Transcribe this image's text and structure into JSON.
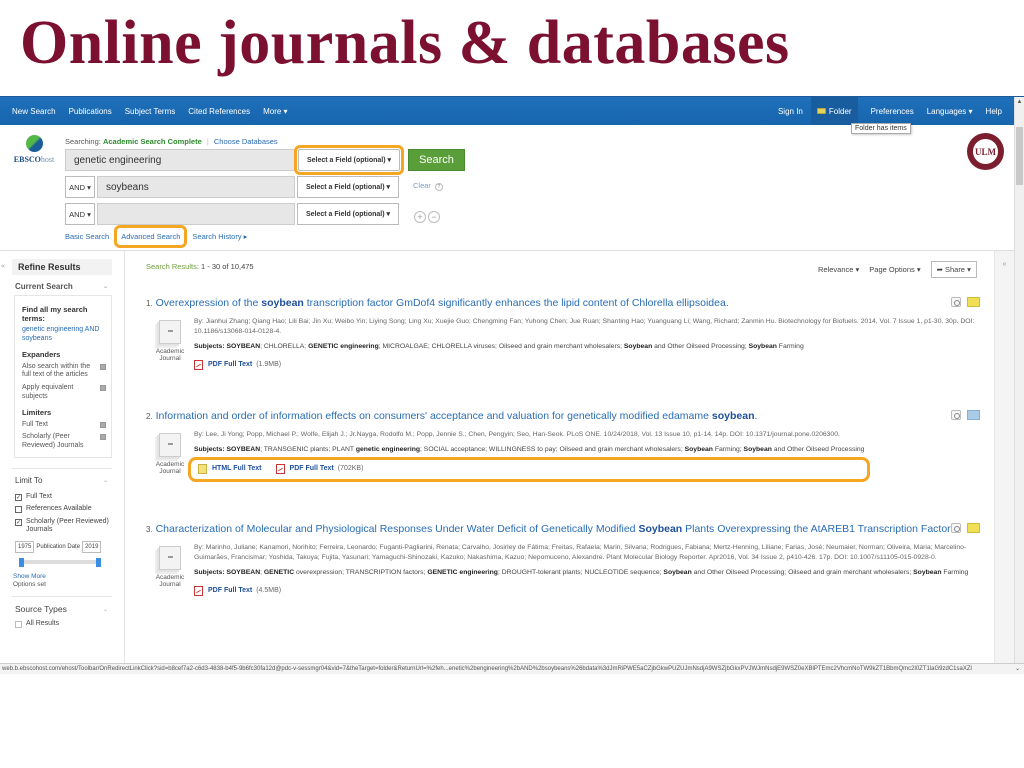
{
  "slide": {
    "title": "Online journals & databases"
  },
  "topnav": {
    "left": [
      "New Search",
      "Publications",
      "Subject Terms",
      "Cited References",
      "More ▾"
    ],
    "sign_in": "Sign In",
    "folder": "Folder",
    "preferences": "Preferences",
    "languages": "Languages ▾",
    "help": "Help",
    "folder_tooltip": "Folder has items"
  },
  "logo": {
    "brand": "EBSCO",
    "brand_suffix": "host"
  },
  "search": {
    "searching_label": "Searching:",
    "database": "Academic Search Complete",
    "choose_databases": "Choose Databases",
    "rows": [
      {
        "bool": "",
        "term": "genetic engineering",
        "field": "Select a Field (optional) ▾"
      },
      {
        "bool": "AND ▾",
        "term": "soybeans",
        "field": "Select a Field (optional) ▾"
      },
      {
        "bool": "AND ▾",
        "term": "",
        "field": "Select a Field (optional) ▾"
      }
    ],
    "search_button": "Search",
    "clear": "Clear",
    "help_glyph": "?",
    "add_row": "+",
    "remove_row": "−",
    "basic_search": "Basic Search",
    "advanced_search": "Advanced Search",
    "search_history": "Search History ▸"
  },
  "institution": {
    "seal_text": "ULM"
  },
  "sidebar": {
    "collapse_glyph": "«",
    "refine_results": "Refine Results",
    "current_search": "Current Search",
    "find_all_label": "Find all my search terms:",
    "find_all_value": "genetic engineering AND soybeans",
    "expanders_label": "Expanders",
    "expanders": [
      "Also search within the full text of the articles",
      "Apply equivalent subjects"
    ],
    "limiters_label": "Limiters",
    "limiters": [
      "Full Text",
      "Scholarly (Peer Reviewed) Journals"
    ],
    "limit_to": "Limit To",
    "limit_options": [
      {
        "label": "Full Text",
        "checked": true
      },
      {
        "label": "References Available",
        "checked": false
      },
      {
        "label": "Scholarly (Peer Reviewed) Journals",
        "checked": true
      }
    ],
    "pub_date_from": "1975",
    "pub_date_label": "Publication Date",
    "pub_date_to": "2019",
    "show_more": "Show More",
    "options_set": "Options set",
    "source_types": "Source Types",
    "all_results": "All Results"
  },
  "results_header": {
    "label": "Search Results:",
    "range": "1 - 30 of 10,475",
    "relevance": "Relevance ▾",
    "page_options": "Page Options ▾",
    "share": "Share ▾"
  },
  "results": [
    {
      "num": "1.",
      "title_pre": "Overexpression of the ",
      "title_bold": "soybean",
      "title_post": " transcription factor GmDof4 significantly enhances the lipid content of Chlorella ellipsoidea.",
      "pub_type": "Academic Journal",
      "byline": "By: Jianhui Zhang; Qiang Hao; Lili Bai; Jin Xu; Weibo Yin; Liying Song; Ling Xu; Xuejie Guo; Chengming Fan; Yuhong Chen; Jue Ruan; Shanting Hao; Yuanguang Li; Wang, Richard; Zanmin Hu. Biotechnology for Biofuels. 2014, Vol. 7 Issue 1, p1-30. 30p. DOI: 10.1186/s13068-014-0128-4.",
      "subjects": [
        {
          "t": "Subjects: ",
          "b": true
        },
        {
          "t": "SOYBEAN",
          "b": true
        },
        {
          "t": "; CHLORELLA; ",
          "b": false
        },
        {
          "t": "GENETIC engineering",
          "b": true
        },
        {
          "t": "; MICROALGAE; CHLORELLA viruses; Oilseed and grain merchant wholesalers; ",
          "b": false
        },
        {
          "t": "Soybean",
          "b": true
        },
        {
          "t": " and Other Oilseed Processing; ",
          "b": false
        },
        {
          "t": "Soybean",
          "b": true
        },
        {
          "t": " Farming",
          "b": false
        }
      ],
      "links": [
        {
          "type": "pdf",
          "label": "PDF Full Text",
          "size": "(1.9MB)"
        }
      ],
      "in_folder": false
    },
    {
      "num": "2.",
      "title_pre": "Information and order of information effects on consumers' acceptance and valuation for genetically modified edamame ",
      "title_bold": "soybean",
      "title_post": ".",
      "pub_type": "Academic Journal",
      "byline": "By: Lee, Ji Yong; Popp, Michael P.; Wolfe, Elijah J.; Jr.Nayga, Rodolfo M.; Popp, Jennie S.; Chen, Pengyin; Seo, Han-Seok. PLoS ONE. 10/24/2018, Vol. 13 Issue 10, p1-14. 14p. DOI: 10.1371/journal.pone.0206300.",
      "subjects": [
        {
          "t": "Subjects: ",
          "b": true
        },
        {
          "t": "SOYBEAN",
          "b": true
        },
        {
          "t": "; TRANSGENIC plants; PLANT ",
          "b": false
        },
        {
          "t": "genetic engineering",
          "b": true
        },
        {
          "t": "; SOCIAL acceptance; WILLINGNESS to pay; Oilseed and grain merchant wholesalers; ",
          "b": false
        },
        {
          "t": "Soybean",
          "b": true
        },
        {
          "t": " Farming; ",
          "b": false
        },
        {
          "t": "Soybean",
          "b": true
        },
        {
          "t": " and Other Oilseed Processing",
          "b": false
        }
      ],
      "links": [
        {
          "type": "html",
          "label": "HTML Full Text",
          "size": ""
        },
        {
          "type": "pdf",
          "label": "PDF Full Text",
          "size": "(702KB)"
        }
      ],
      "in_folder": true
    },
    {
      "num": "3.",
      "title_pre": "Characterization of Molecular and Physiological Responses Under Water Deficit of Genetically Modified ",
      "title_bold": "Soybean",
      "title_post": " Plants Overexpressing the AtAREB1 Transcription Factor.",
      "pub_type": "Academic Journal",
      "byline": "By: Marinho, Juliane; Kanamori, Norihito; Ferreira, Leonardo; Fuganti-Pagliarini, Renata; Carvalho, Josirley de Fátima; Freitas, Rafaela; Marin, Silvana; Rodrigues, Fabiana; Mertz-Henning, Liliane; Farias, José; Neumaier, Norman; Oliveira, Maria; Marcelino-Guimarães, Francismar; Yoshida, Takuya; Fujita, Yasunari; Yamaguchi-Shinozaki, Kazuko; Nakashima, Kazuo; Nepomuceno, Alexandre. Plant Molecular Biology Reporter. Apr2016, Vol. 34 Issue 2, p410-426. 17p. DOI: 10.1007/s11105-015-0928-0.",
      "subjects": [
        {
          "t": "Subjects: ",
          "b": true
        },
        {
          "t": "SOYBEAN",
          "b": true
        },
        {
          "t": "; ",
          "b": false
        },
        {
          "t": "GENETIC",
          "b": true
        },
        {
          "t": " overexpression; TRANSCRIPTION factors; ",
          "b": false
        },
        {
          "t": "GENETIC engineering",
          "b": true
        },
        {
          "t": "; DROUGHT-tolerant plants; NUCLEOTIDE sequence; ",
          "b": false
        },
        {
          "t": "Soybean",
          "b": true
        },
        {
          "t": " and Other Oilseed Processing; Oilseed and grain merchant wholesalers; ",
          "b": false
        },
        {
          "t": "Soybean",
          "b": true
        },
        {
          "t": " Farming",
          "b": false
        }
      ],
      "links": [
        {
          "type": "pdf",
          "label": "PDF Full Text",
          "size": "(4.5MB)"
        }
      ],
      "in_folder": false
    }
  ],
  "statusbar": {
    "url": "web.b.ebscohost.com/ehost/Toolbar/OnRedirectLinkClick?sid=b8cef7a2-c6d3-4838-b4f5-9b6fc30fa12d@pdc-v-sessmgr04&vid=7&theTarget=folder&ReturnUrl=%2feh...enetic%2bengineering%2bAND%2bsoybeans%26bdata%3dJmRiPWE5aCZjbGkwPUZUJmNsdjA9WSZjbGkxPVJWJmNsdjE9WSZ0eXBlPTEmc2VhcmNoTW9kZT1BbmQmc2l0ZT1laG9zdC1saXZl"
  }
}
